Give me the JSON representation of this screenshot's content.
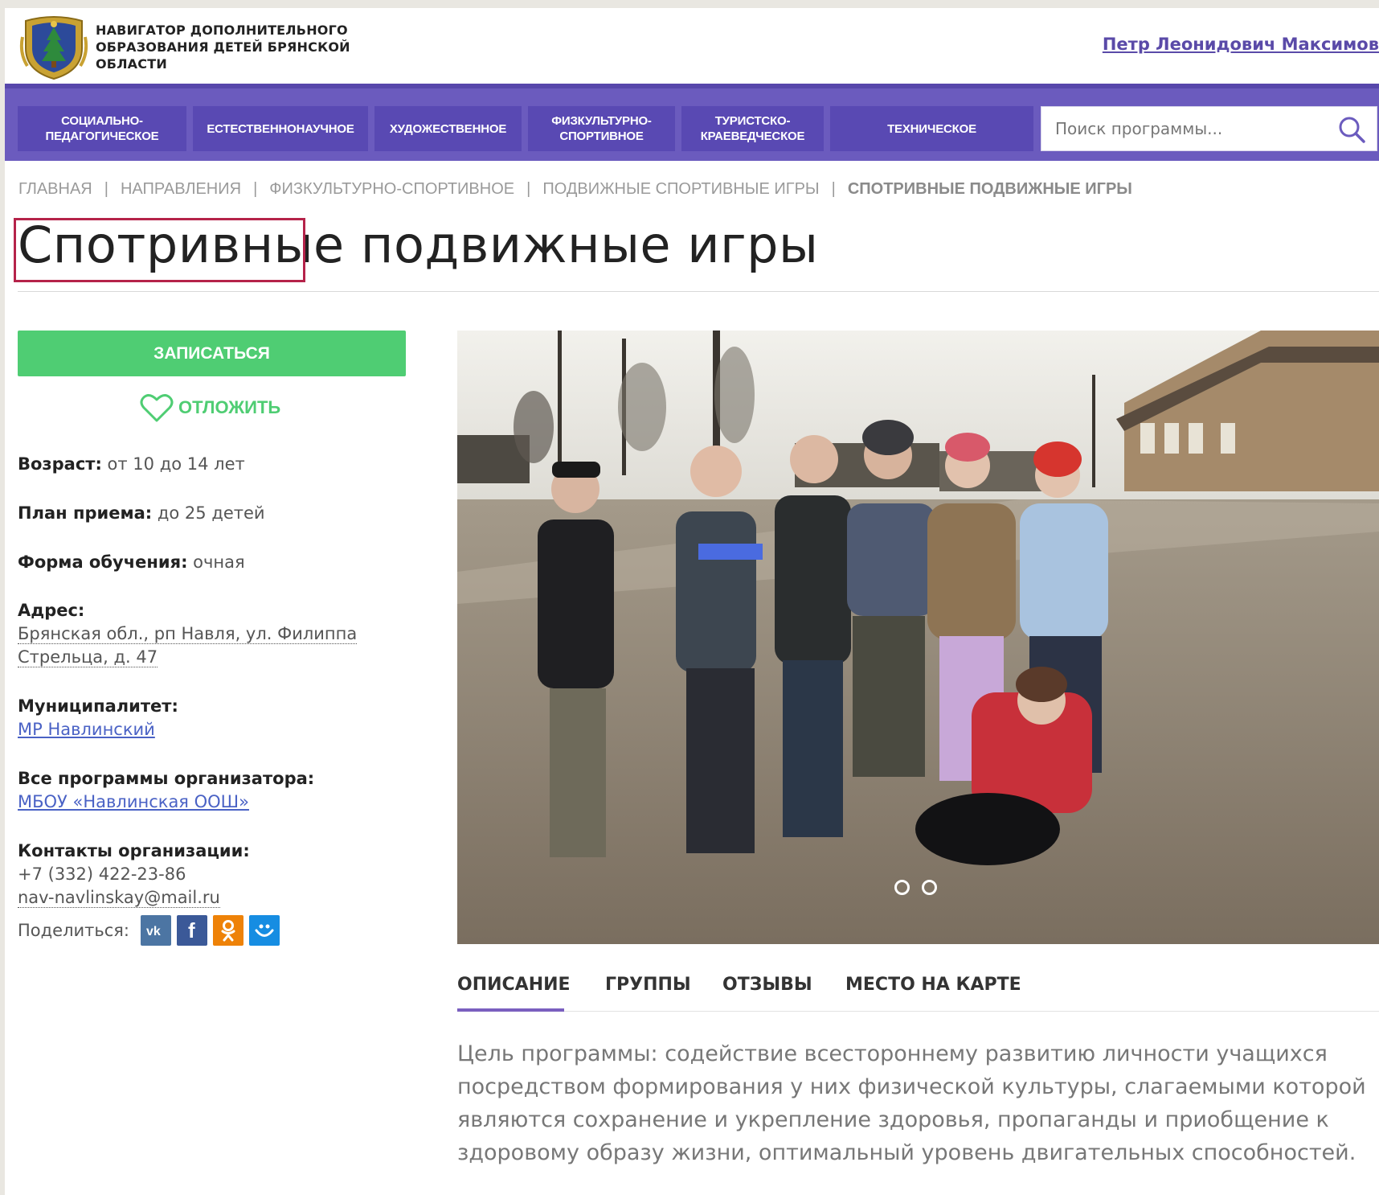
{
  "header": {
    "brand_line1": "Навигатор дополнительного",
    "brand_line2": "образования детей Брянской",
    "brand_line3": "области",
    "user_name": "Петр Леонидович Максимов"
  },
  "nav": {
    "items": [
      {
        "label": "Социально-педагогическое"
      },
      {
        "label": "Естественнонаучное"
      },
      {
        "label": "Художественное"
      },
      {
        "label": "Физкультурно-спортивное"
      },
      {
        "label": "Туристско-краеведческое"
      },
      {
        "label": "Техническое"
      }
    ],
    "search_placeholder": "Поиск программы..."
  },
  "breadcrumb": {
    "items": [
      "Главная",
      "Направления",
      "Физкультурно-спортивное",
      "Подвижные спортивные игры",
      "Спотривные подвижные игры"
    ]
  },
  "page_title": {
    "highlighted": "Спотривные",
    "rest": "подвижные игры"
  },
  "actions": {
    "enroll_label": "Записаться",
    "postpone_label": "Отложить"
  },
  "details": {
    "age_label": "Возраст:",
    "age_value": "от 10 до 14 лет",
    "plan_label": "План приема:",
    "plan_value": "до 25 детей",
    "form_label": "Форма обучения:",
    "form_value": "очная",
    "address_label": "Адрес:",
    "address_line1": "Брянская обл., рп Навля, ул. Филиппа",
    "address_line2": "Стрельца, д. 47",
    "municipality_label": "Муниципалитет:",
    "municipality_value": "МР Навлинский",
    "organizer_label": "Все программы организатора:",
    "organizer_value": "МБОУ «Навлинская ООШ»",
    "contacts_label": "Контакты организации:",
    "phone": "+7 (332) 422-23-86",
    "email": "nav-navlinskay@mail.ru",
    "share_label": "Поделиться:"
  },
  "social": [
    {
      "icon": "vk-icon",
      "glyph": "vk",
      "color": "#4c75a3"
    },
    {
      "icon": "facebook-icon",
      "glyph": "f",
      "color": "#3b5998"
    },
    {
      "icon": "odnoklassniki-icon",
      "glyph": "ok",
      "color": "#ee8208"
    },
    {
      "icon": "moimir-icon",
      "glyph": "@",
      "color": "#168de2"
    }
  ],
  "tabs": [
    {
      "label": "Описание",
      "active": true
    },
    {
      "label": "Группы",
      "active": false
    },
    {
      "label": "Отзывы",
      "active": false
    },
    {
      "label": "Место на карте",
      "active": false
    }
  ],
  "description": "Цель программы: содействие всестороннему развитию личности учащихся посредством формирования у них физической культуры, слагаемыми которой являются сохранение и укрепление здоровья, пропаганды и приобщение к здоровому образу жизни, оптимальный уровень двигательных способностей.",
  "colors": {
    "nav_bg": "#6b5bbe",
    "nav_item_bg": "#5949b3",
    "enroll_green": "#4fcd73",
    "title_highlight": "#b5234a",
    "link_blue": "#4a62c5"
  }
}
